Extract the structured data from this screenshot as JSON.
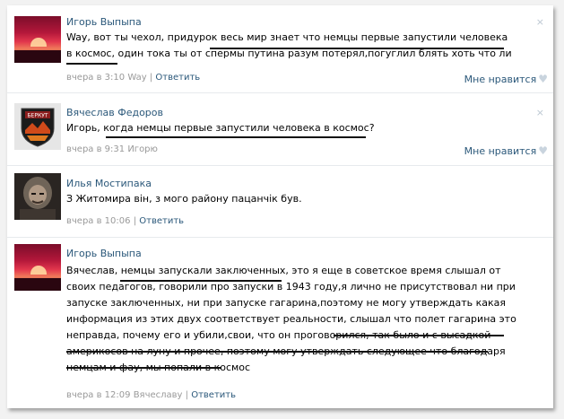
{
  "comments": [
    {
      "author": "Игорь Выпыпа",
      "lines": [
        "Way, вот ты чехол, придурок весь мир знает что немцы первые запустили человека",
        "в космос, один тока ты от спермы путина разум потерял,погуглил блять хоть что ли"
      ],
      "time": "вчера в 3:10",
      "reply_to": "Way",
      "reply_label": "Ответить",
      "like_label": "Мне нравится",
      "avatar_icon": "sunset-avatar"
    },
    {
      "author": "Вячеслав Федоров",
      "lines": [
        "Игорь, когда немцы первые запустили человека в космос?"
      ],
      "time": "вчера в 9:31",
      "reply_to": "Игорю",
      "like_label": "Мне нравится",
      "avatar_icon": "beriku-badge-avatar",
      "avatar_text": "БЕРКУТ"
    },
    {
      "author": "Илья Мостипака",
      "lines": [
        "З Житомира він, з мого району пацанчік був."
      ],
      "time": "вчера в 10:06",
      "reply_label": "Ответить",
      "avatar_icon": "photo-avatar"
    },
    {
      "author": "Игорь Выпыпа",
      "lines": [
        "Вячеслав, немцы запускали заключенных, это я еще в советское время слышал от",
        "своих педагогов, говорили про запуски в 1943 году,я лично не присутствовал ни при",
        "запуске заключенных, ни при запуске гагарина,поэтому не могу утверждать какая",
        "информация из этих двух соответствует реальности, слышал что полет гагарина это",
        "неправда, почему его и убили,свои, что он проговорился, так было и с высадкой",
        "америкосов на луну и прочее, поэтому могу утверждать следующее что благодаря",
        "немцам и фау, мы попали в космос"
      ],
      "time": "вчера в 12:09",
      "reply_to": "Вячеславу",
      "reply_label": "Ответить",
      "avatar_icon": "sunset-avatar"
    }
  ],
  "ui": {
    "close_glyph": "×",
    "heart_glyph": "♥",
    "separator": "|"
  },
  "colors": {
    "link": "#2b587a",
    "meta": "#999999",
    "separator_line": "#e7eaed"
  }
}
